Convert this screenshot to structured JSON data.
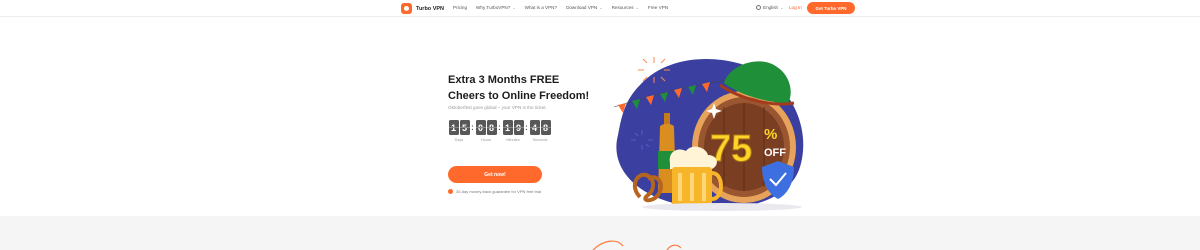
{
  "header": {
    "brand": "Turbo VPN",
    "nav": [
      {
        "label": "Pricing",
        "dropdown": false
      },
      {
        "label": "Why TurboVPN?",
        "dropdown": true
      },
      {
        "label": "What is a VPN?",
        "dropdown": false
      },
      {
        "label": "Download VPN",
        "dropdown": true
      },
      {
        "label": "Resources",
        "dropdown": true
      },
      {
        "label": "Free VPN",
        "dropdown": false
      }
    ],
    "language": "English",
    "login": "Log In",
    "cta": "Get Turbo VPN"
  },
  "hero": {
    "title_line1": "Extra 3 Months FREE",
    "title_line2": "Cheers to Online Freedom!",
    "subtitle": "Oktoberfest goes global – your VPN is the ticket.",
    "countdown": [
      {
        "value": "15",
        "label": "Days"
      },
      {
        "value": "08",
        "label": "Hours"
      },
      {
        "value": "19",
        "label": "Minutes"
      },
      {
        "value": "48",
        "label": "Seconds"
      }
    ],
    "cta": "Get now!",
    "guarantee": "30-day money-back guarantee for VPN free trial"
  },
  "promo": {
    "discount": "75",
    "percent": "%",
    "off": "OFF"
  },
  "colors": {
    "accent": "#ff6a2c",
    "blob": "#3a3fa0",
    "barrel": "#8b4a2b",
    "hat": "#1f8f3a",
    "gold": "#ffd42a"
  }
}
